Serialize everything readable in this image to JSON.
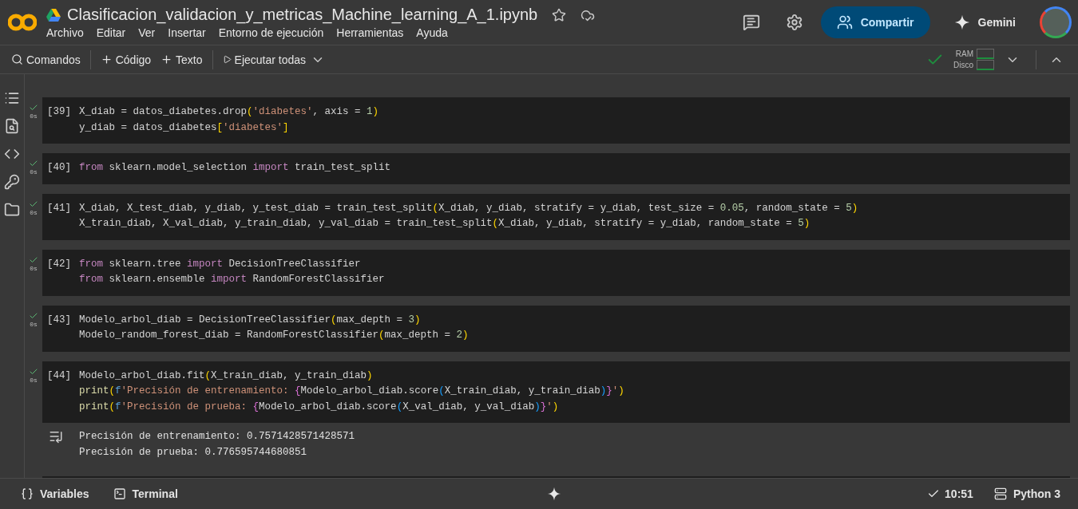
{
  "header": {
    "title": "Clasificacion_validacion_y_metricas_Machine_learning_A_1.ipynb",
    "menu": [
      "Archivo",
      "Editar",
      "Ver",
      "Insertar",
      "Entorno de ejecución",
      "Herramientas",
      "Ayuda"
    ],
    "share_label": "Compartir",
    "gemini_label": "Gemini"
  },
  "toolbar": {
    "commands": "Comandos",
    "add_code": "Código",
    "add_text": "Texto",
    "run_all": "Ejecutar todas",
    "connected": true,
    "ram_label": "RAM",
    "disk_label": "Disco"
  },
  "cells": [
    {
      "count": "[39]",
      "ran": true,
      "time": "0s",
      "lines": [
        [
          {
            "t": "X_diab = datos_diabetes.drop",
            "kind": "plain"
          },
          {
            "t": "(",
            "kind": "bracket"
          },
          {
            "t": "'diabetes'",
            "kind": "string"
          },
          {
            "t": ", axis = ",
            "kind": "plain"
          },
          {
            "t": "1",
            "kind": "number"
          },
          {
            "t": ")",
            "kind": "bracket"
          }
        ],
        [
          {
            "t": "y_diab = datos_diabetes",
            "kind": "plain"
          },
          {
            "t": "[",
            "kind": "bracket"
          },
          {
            "t": "'diabetes'",
            "kind": "string"
          },
          {
            "t": "]",
            "kind": "bracket"
          }
        ]
      ]
    },
    {
      "count": "[40]",
      "ran": true,
      "time": "0s",
      "lines": [
        [
          {
            "t": "from",
            "kind": "keyword"
          },
          {
            "t": " sklearn.model_selection ",
            "kind": "plain"
          },
          {
            "t": "import",
            "kind": "keyword"
          },
          {
            "t": " train_test_split",
            "kind": "plain"
          }
        ]
      ]
    },
    {
      "count": "[41]",
      "ran": true,
      "time": "0s",
      "lines": [
        [
          {
            "t": "X_diab, X_test_diab, y_diab, y_test_diab = train_test_split",
            "kind": "plain"
          },
          {
            "t": "(",
            "kind": "bracket"
          },
          {
            "t": "X_diab, y_diab, stratify = y_diab, test_size = ",
            "kind": "plain"
          },
          {
            "t": "0.05",
            "kind": "number"
          },
          {
            "t": ", random_state = ",
            "kind": "plain"
          },
          {
            "t": "5",
            "kind": "number"
          },
          {
            "t": ")",
            "kind": "bracket"
          }
        ],
        [
          {
            "t": "X_train_diab, X_val_diab, y_train_diab, y_val_diab = train_test_split",
            "kind": "plain"
          },
          {
            "t": "(",
            "kind": "bracket"
          },
          {
            "t": "X_diab, y_diab, stratify = y_diab, random_state = ",
            "kind": "plain"
          },
          {
            "t": "5",
            "kind": "number"
          },
          {
            "t": ")",
            "kind": "bracket"
          }
        ]
      ]
    },
    {
      "count": "[42]",
      "ran": true,
      "time": "0s",
      "lines": [
        [
          {
            "t": "from",
            "kind": "keyword"
          },
          {
            "t": " sklearn.tree ",
            "kind": "plain"
          },
          {
            "t": "import",
            "kind": "keyword"
          },
          {
            "t": " DecisionTreeClassifier",
            "kind": "plain"
          }
        ],
        [
          {
            "t": "from",
            "kind": "keyword"
          },
          {
            "t": " sklearn.ensemble ",
            "kind": "plain"
          },
          {
            "t": "import",
            "kind": "keyword"
          },
          {
            "t": " RandomForestClassifier",
            "kind": "plain"
          }
        ]
      ]
    },
    {
      "count": "[43]",
      "ran": true,
      "time": "0s",
      "lines": [
        [
          {
            "t": "Modelo_arbol_diab = DecisionTreeClassifier",
            "kind": "plain"
          },
          {
            "t": "(",
            "kind": "bracket"
          },
          {
            "t": "max_depth = ",
            "kind": "plain"
          },
          {
            "t": "3",
            "kind": "number"
          },
          {
            "t": ")",
            "kind": "bracket"
          }
        ],
        [
          {
            "t": "Modelo_random_forest_diab = RandomForestClassifier",
            "kind": "plain"
          },
          {
            "t": "(",
            "kind": "bracket"
          },
          {
            "t": "max_depth = ",
            "kind": "plain"
          },
          {
            "t": "2",
            "kind": "number"
          },
          {
            "t": ")",
            "kind": "bracket"
          }
        ]
      ]
    },
    {
      "count": "[44]",
      "ran": true,
      "time": "0s",
      "lines": [
        [
          {
            "t": "Modelo_arbol_diab.fit",
            "kind": "plain"
          },
          {
            "t": "(",
            "kind": "bracket"
          },
          {
            "t": "X_train_diab, y_train_diab",
            "kind": "plain"
          },
          {
            "t": ")",
            "kind": "bracket"
          }
        ],
        [
          {
            "t": "print",
            "kind": "builtin"
          },
          {
            "t": "(",
            "kind": "bracket"
          },
          {
            "t": "f",
            "kind": "prefix"
          },
          {
            "t": "'Precisión de entrenamiento: ",
            "kind": "string"
          },
          {
            "t": "{",
            "kind": "brace"
          },
          {
            "t": "Modelo_arbol_diab.score",
            "kind": "plain"
          },
          {
            "t": "(",
            "kind": "paren"
          },
          {
            "t": "X_train_diab, y_train_diab",
            "kind": "plain"
          },
          {
            "t": ")",
            "kind": "paren"
          },
          {
            "t": "}",
            "kind": "brace"
          },
          {
            "t": "'",
            "kind": "string"
          },
          {
            "t": ")",
            "kind": "bracket"
          }
        ],
        [
          {
            "t": "print",
            "kind": "builtin"
          },
          {
            "t": "(",
            "kind": "bracket"
          },
          {
            "t": "f",
            "kind": "prefix"
          },
          {
            "t": "'Precisión de prueba: ",
            "kind": "string"
          },
          {
            "t": "{",
            "kind": "brace"
          },
          {
            "t": "Modelo_arbol_diab.score",
            "kind": "plain"
          },
          {
            "t": "(",
            "kind": "paren"
          },
          {
            "t": "X_val_diab, y_val_diab",
            "kind": "plain"
          },
          {
            "t": ")",
            "kind": "paren"
          },
          {
            "t": "}",
            "kind": "brace"
          },
          {
            "t": "'",
            "kind": "string"
          },
          {
            "t": ")",
            "kind": "bracket"
          }
        ]
      ],
      "output": [
        "Precisión de entrenamiento: 0.7571428571428571",
        "Precisión de prueba: 0.776595744680851"
      ]
    }
  ],
  "status_bar": {
    "variables": "Variables",
    "terminal": "Terminal",
    "time": "10:51",
    "runtime": "Python 3"
  }
}
